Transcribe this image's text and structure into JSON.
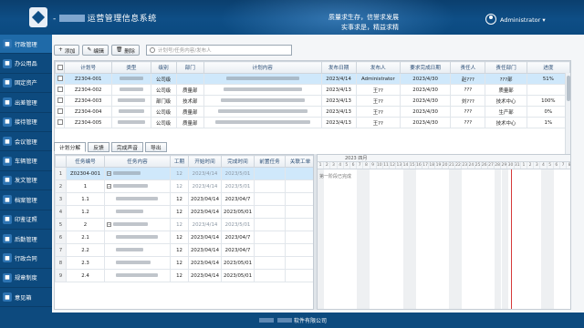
{
  "header": {
    "title": "运营管理信息系统",
    "slogan_line1": "质量求生存，信誉求发展",
    "slogan_line2": "实事求是，精益求精",
    "user": "Administrator ▾"
  },
  "sidebar": {
    "items": [
      {
        "label": "行政管理",
        "icon": "home-icon"
      },
      {
        "label": "办公用品",
        "icon": "clipboard-icon"
      },
      {
        "label": "固定资产",
        "icon": "building-icon"
      },
      {
        "label": "出差管理",
        "icon": "plane-icon"
      },
      {
        "label": "接待管理",
        "icon": "handshake-icon"
      },
      {
        "label": "会议管理",
        "icon": "meeting-icon"
      },
      {
        "label": "车辆管理",
        "icon": "car-icon"
      },
      {
        "label": "发文管理",
        "icon": "document-icon"
      },
      {
        "label": "档案管理",
        "icon": "folder-icon"
      },
      {
        "label": "印鉴证照",
        "icon": "seal-icon"
      },
      {
        "label": "后勤管理",
        "icon": "tools-icon"
      },
      {
        "label": "行政合同",
        "icon": "contract-icon"
      },
      {
        "label": "规章制度",
        "icon": "rules-icon"
      },
      {
        "label": "意见箱",
        "icon": "mailbox-icon"
      }
    ]
  },
  "toolbar": {
    "add": "添加",
    "edit": "编辑",
    "delete": "删除",
    "search_placeholder": "计划号/任务内容/发布人"
  },
  "plan_table": {
    "columns": [
      "",
      "计划号",
      "类型",
      "级别",
      "部门",
      "计划内容",
      "发布日期",
      "发布人",
      "要求完成日期",
      "责任人",
      "责任部门",
      "进度"
    ],
    "rows": [
      {
        "id": "Z2304-001",
        "type": "",
        "level": "公司级",
        "dept": "",
        "content": "",
        "date": "2023/4/14",
        "publisher": "Administrator",
        "due": "2023/4/30",
        "owner": "赵???",
        "owner_dept": "???部",
        "progress": "51%",
        "selected": true
      },
      {
        "id": "Z2304-002",
        "type": "",
        "level": "公司级",
        "dept": "质量部",
        "content": "",
        "date": "2023/4/13",
        "publisher": "王??",
        "due": "2023/4/30",
        "owner": "???",
        "owner_dept": "质量部",
        "progress": ""
      },
      {
        "id": "Z2304-003",
        "type": "",
        "level": "部门级",
        "dept": "技术部",
        "content": "",
        "date": "2023/4/13",
        "publisher": "王??",
        "due": "2023/4/30",
        "owner": "刘???",
        "owner_dept": "技术中心",
        "progress": "100%"
      },
      {
        "id": "Z2304-004",
        "type": "",
        "level": "公司级",
        "dept": "质量部",
        "content": "",
        "date": "2023/4/13",
        "publisher": "王??",
        "due": "2023/4/30",
        "owner": "???",
        "owner_dept": "生产部",
        "progress": "0%"
      },
      {
        "id": "Z2304-005",
        "type": "",
        "level": "公司级",
        "dept": "质量部",
        "content": "",
        "date": "2023/4/13",
        "publisher": "王??",
        "due": "2023/4/30",
        "owner": "???",
        "owner_dept": "技术中心",
        "progress": "1%"
      }
    ]
  },
  "detail_tabs": [
    "计划分解",
    "反馈",
    "完成声音",
    "导出"
  ],
  "task_table": {
    "columns": [
      "",
      "任务编号",
      "任务内容",
      "工期",
      "开始时间",
      "完成时间",
      "前置任务",
      "关联工单"
    ],
    "rows": [
      {
        "n": "1",
        "code": "Z02304-001",
        "dur": "12",
        "start": "2023/4/14",
        "end": "2023/5/01",
        "grey": true
      },
      {
        "n": "2",
        "code": "1",
        "dur": "12",
        "start": "2023/4/14",
        "end": "2023/5/01",
        "grey": true
      },
      {
        "n": "3",
        "code": "1.1",
        "dur": "12",
        "start": "2023/04/14",
        "end": "2023/04/7",
        "grey": false
      },
      {
        "n": "4",
        "code": "1.2",
        "dur": "12",
        "start": "2023/04/14",
        "end": "2023/05/01",
        "grey": false
      },
      {
        "n": "5",
        "code": "2",
        "dur": "12",
        "start": "2023/4/14",
        "end": "2023/5/01",
        "grey": true
      },
      {
        "n": "6",
        "code": "2.1",
        "dur": "12",
        "start": "2023/04/14",
        "end": "2023/04/7",
        "grey": false
      },
      {
        "n": "7",
        "code": "2.2",
        "dur": "12",
        "start": "2023/04/14",
        "end": "2023/04/7",
        "grey": false
      },
      {
        "n": "8",
        "code": "2.3",
        "dur": "12",
        "start": "2023/04/14",
        "end": "2023/05/01",
        "grey": false
      },
      {
        "n": "9",
        "code": "2.4",
        "dur": "12",
        "start": "2023/04/14",
        "end": "2023/05/01",
        "grey": false
      }
    ]
  },
  "gantt": {
    "month_label": "2023 四月",
    "days": [
      "1",
      "2",
      "3",
      "4",
      "5",
      "6",
      "7",
      "8",
      "9",
      "10",
      "11",
      "12",
      "13",
      "14",
      "15",
      "16",
      "17",
      "18",
      "19",
      "20",
      "21",
      "22",
      "23",
      "24",
      "25",
      "26",
      "27",
      "28",
      "29",
      "30",
      "31",
      "1",
      "2",
      "3",
      "4",
      "5",
      "6",
      "7",
      "8",
      "9",
      "10",
      "11",
      "12",
      "13"
    ],
    "row_label": "第一阶段已完成",
    "today_index": 29
  },
  "footer": {
    "text": "软件有限公司"
  }
}
